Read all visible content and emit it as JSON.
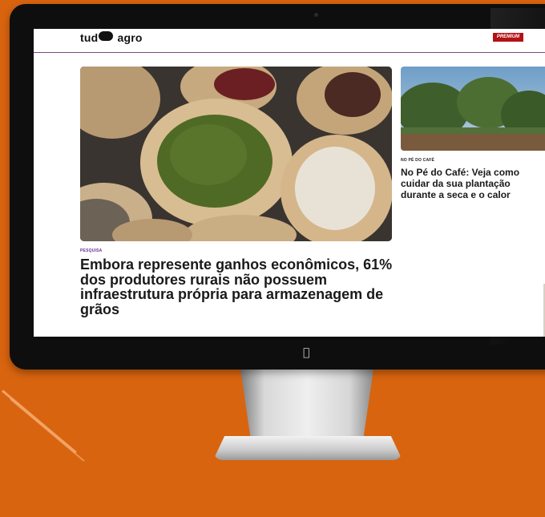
{
  "site": {
    "logo_text_left": "tud",
    "logo_text_right": "agro",
    "badge_label": "PREMIUM"
  },
  "hero": {
    "category": "PESQUISA",
    "headline": "Embora represente ganhos econômicos, 61% dos produtores rurais não possuem infraestrutura própria para armazenagem de grãos"
  },
  "side_story": {
    "category": "NO PÉ DO CAFÉ",
    "headline": "No Pé do Café: Veja como cuidar da sua plantação durante a seca e o calor"
  },
  "device": {
    "logo_icon": "apple-icon"
  },
  "colors": {
    "background": "#d9640f",
    "accent": "#6a2d8f",
    "bezel": "#0e0e0e"
  }
}
